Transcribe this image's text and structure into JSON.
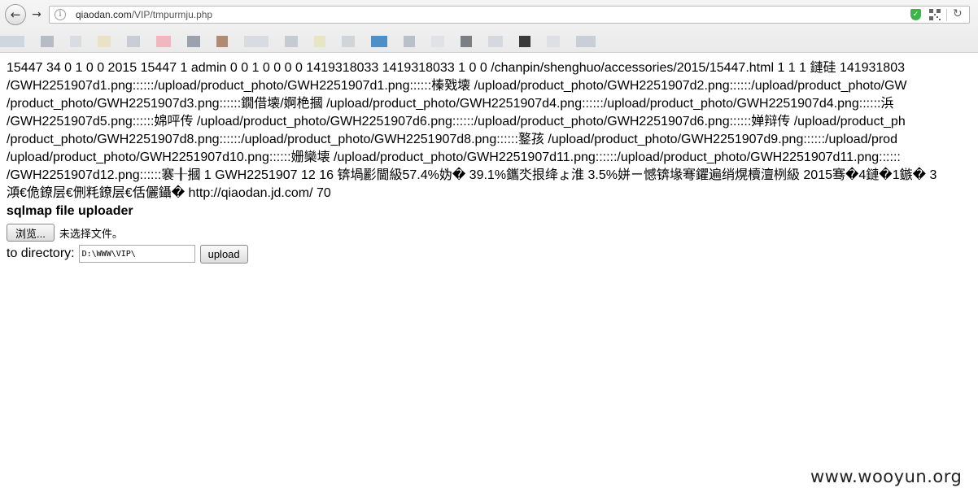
{
  "browser": {
    "url_host": "qiaodan.com",
    "url_path": "/VIP/tmpurmju.php",
    "icons": {
      "back": "back-arrow-icon",
      "forward": "forward-arrow-icon",
      "site_info": "info-icon",
      "security": "shield-check-icon",
      "qr": "qr-code-icon",
      "reload": "reload-icon"
    },
    "info_glyph": "i",
    "back_glyph": "←",
    "forward_glyph": "→",
    "reload_glyph": "↻",
    "shield_glyph": "✓",
    "bookmark_colors": [
      "#cfd6e0",
      "#b5bcc6",
      "#d9dde3",
      "#e9e2c4",
      "#c9ced6",
      "#f1b6be",
      "#9aa2ad",
      "#b08a72",
      "#d8dce2",
      "#c5cbd3",
      "#e8e5c4",
      "#d0d5dc",
      "#4f8fc7",
      "#b9c0c9",
      "#dfe3e8",
      "#7a7f86",
      "#d5d9df",
      "#3a3a3a",
      "#dde1e6",
      "#c9cfd6"
    ]
  },
  "dump": {
    "lines": [
      "15447 34 0 1 0 0 2015 15447 1 admin 0 0 1 0 0 0 0 1419318033 1419318033 1 0 0 /chanpin/shenghuo/accessories/2015/15447.html 1 1 1 鏈硅 141931803",
      "/GWH2251907d1.png::::::/upload/product_photo/GWH2251907d1.png::::::榛戣壊 /upload/product_photo/GWH2251907d2.png::::::/upload/product_photo/GW",
      "/product_photo/GWH2251907d3.png::::::鐗借壊/婀栬摑 /upload/product_photo/GWH2251907d4.png::::::/upload/product_photo/GWH2251907d4.png::::::浜",
      "/GWH2251907d5.png::::::婂呯传 /upload/product_photo/GWH2251907d6.png::::::/upload/product_photo/GWH2251907d6.png::::::婵辩传 /upload/product_ph",
      "/product_photo/GWH2251907d8.png::::::/upload/product_photo/GWH2251907d8.png::::::鐜孩 /upload/product_photo/GWH2251907d9.png::::::/upload/prod",
      "/upload/product_photo/GWH2251907d10.png::::::姗欒壊 /upload/product_photo/GWH2251907d11.png::::::/upload/product_photo/GWH2251907d11.png::::::",
      "/GWH2251907d12.png::::::褰╂摑 1 GWH2251907 12 16 锛堝彲閫級57.4%妫� 39.1%鑴氼拫绛ょ淮 3.5%姘ㄧ憾锛堟弿鑺遍绡熀櫝澶栵級 2015骞�4鏈�1鏃� 3 ",
      "澒€佹鐐层€侀粍鐐层€佸儷鑷� http://qiaodan.jd.com/ 70"
    ]
  },
  "uploader": {
    "title": "sqlmap file uploader",
    "browse_label": "浏览...",
    "no_file_text": "未选择文件。",
    "dir_label": "to directory:",
    "dir_value": "D:\\WWW\\VIP\\",
    "upload_label": "upload"
  },
  "watermark": "www.wooyun.org"
}
